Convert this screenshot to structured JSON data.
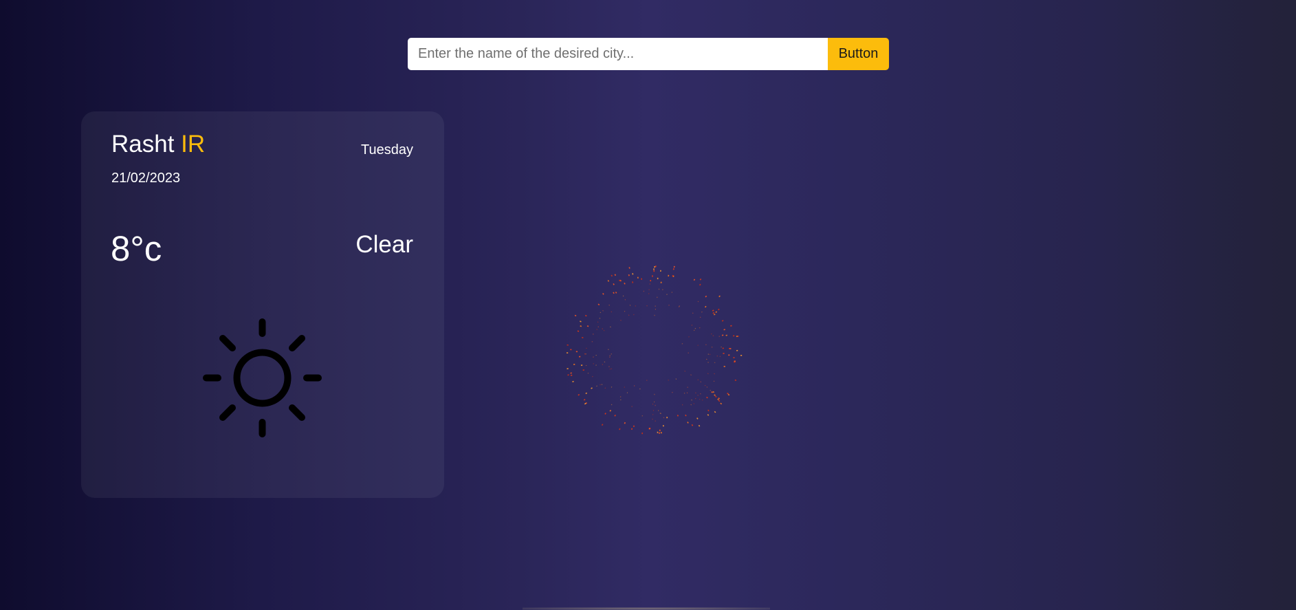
{
  "search": {
    "placeholder": "Enter the name of the desired city...",
    "value": "",
    "button_label": "Button"
  },
  "weather": {
    "city": "Rasht",
    "country": "IR",
    "day": "Tuesday",
    "date": "21/02/2023",
    "temperature": "8°c",
    "condition": "Clear",
    "icon": "sun-icon"
  },
  "colors": {
    "accent": "#fcbc0c",
    "text": "#ffffff",
    "firework": "#ff5a1f"
  }
}
